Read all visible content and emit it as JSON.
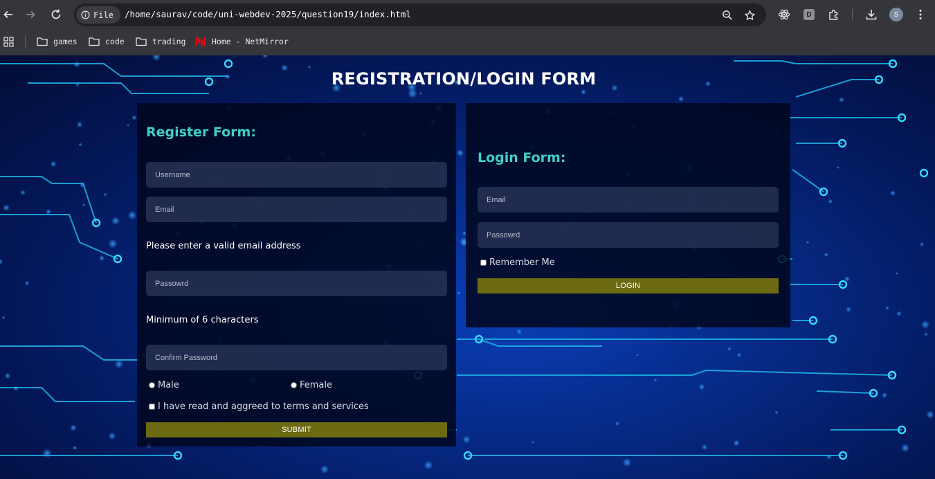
{
  "browser": {
    "file_label": "File",
    "url": "/home/saurav/code/uni-webdev-2025/question19/index.html",
    "profile_letter": "D",
    "avatar_letter": "S",
    "bookmarks": [
      "games",
      "code",
      "trading",
      "Home - NetMirror"
    ]
  },
  "page": {
    "title": "REGISTRATION/LOGIN FORM",
    "register": {
      "heading": "Register Form:",
      "username_placeholder": "Username",
      "email_placeholder": "Email",
      "email_hint": "Please enter a valid email address",
      "password_placeholder": "Passowrd",
      "password_hint": "Minimum of 6 characters",
      "confirm_placeholder": "Confirm Password",
      "gender_male": "Male",
      "gender_female": "Female",
      "terms_label": "I have read and aggreed to terms and services",
      "submit_label": "SUBMIT"
    },
    "login": {
      "heading": "Login Form:",
      "email_placeholder": "Email",
      "password_placeholder": "Passowrd",
      "remember_label": "Remember Me",
      "login_label": "LOGIN"
    }
  }
}
